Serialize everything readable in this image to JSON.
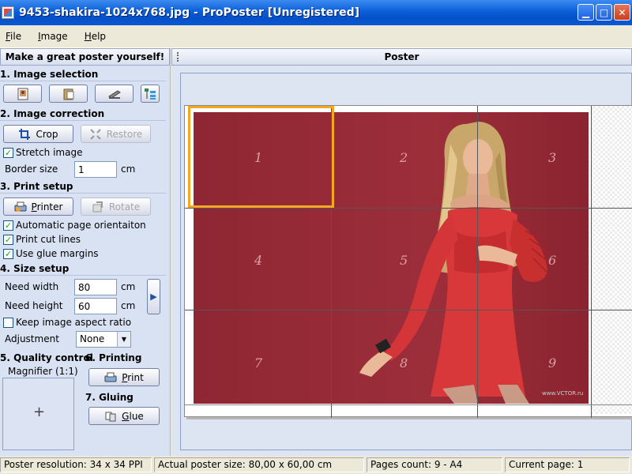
{
  "window": {
    "title": "9453-shakira-1024x768.jpg - ProPoster [Unregistered]"
  },
  "menu": [
    "File",
    "Image",
    "Help"
  ],
  "left_panel": {
    "header": "Make a great poster yourself!",
    "image_selection": {
      "title": "1. Image selection"
    },
    "image_correction": {
      "title": "2. Image correction",
      "crop_label": "Crop",
      "restore_label": "Restore",
      "stretch_label": "Stretch image",
      "stretch_checked": true,
      "border_label": "Border size",
      "border_value": "1",
      "border_unit": "cm"
    },
    "print_setup": {
      "title": "3. Print setup",
      "printer_label": "Printer",
      "rotate_label": "Rotate",
      "auto_orient_label": "Automatic page orientaiton",
      "cut_lines_label": "Print cut lines",
      "glue_margins_label": "Use glue margins"
    },
    "size_setup": {
      "title": "4. Size setup",
      "width_label": "Need width",
      "width_value": "80",
      "width_unit": "cm",
      "height_label": "Need height",
      "height_value": "60",
      "height_unit": "cm",
      "aspect_label": "Keep image aspect ratio",
      "adjust_label": "Adjustment",
      "adjust_value": "None"
    },
    "quality": {
      "title": "5. Quality control",
      "magnifier_label": "Magnifier (1:1)"
    },
    "printing": {
      "title": "6. Printing",
      "print_label": "Print"
    },
    "gluing": {
      "title": "7. Gluing",
      "glue_label": "Glue"
    }
  },
  "poster": {
    "header": "Poster",
    "tiles": [
      "1",
      "2",
      "3",
      "4",
      "5",
      "6",
      "7",
      "8",
      "9"
    ],
    "selected_tile": 1,
    "watermark": "www.VCTOR.ru"
  },
  "status": {
    "resolution": "Poster resolution: 34 x 34 PPI",
    "actual_size": "Actual poster size: 80,00 x 60,00 cm",
    "pages": "Pages count: 9 - A4",
    "current": "Current page: 1"
  },
  "colors": {
    "titlebar": "#0a5fd8",
    "selection": "#f5a623",
    "photo_bg": "#8e2733"
  }
}
